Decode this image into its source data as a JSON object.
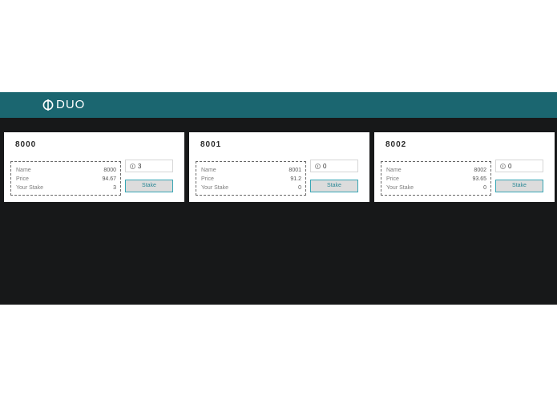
{
  "header": {
    "brand": "DUO"
  },
  "labels": {
    "name": "Name",
    "price": "Price",
    "your_stake": "Your Stake"
  },
  "cards": [
    {
      "title": "8000",
      "name": "8000",
      "price": "94.67",
      "your_stake": "3",
      "input_value": "3",
      "button_label": "Stake"
    },
    {
      "title": "8001",
      "name": "8001",
      "price": "91.2",
      "your_stake": "0",
      "input_value": "0",
      "button_label": "Stake"
    },
    {
      "title": "8002",
      "name": "8002",
      "price": "93.65",
      "your_stake": "0",
      "input_value": "0",
      "button_label": "Stake"
    }
  ],
  "colors": {
    "header": "#1b6670",
    "background": "#171819",
    "accent": "#38a6b4"
  }
}
